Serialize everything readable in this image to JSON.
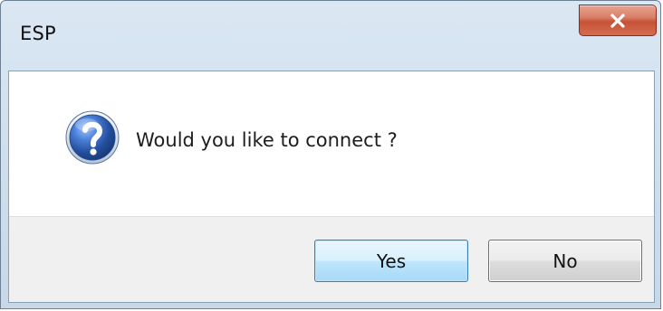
{
  "window": {
    "title": "ESP",
    "close_glyph": "x"
  },
  "dialog": {
    "icon": "question-icon",
    "message": "Would you like to connect ?"
  },
  "buttons": {
    "yes_label": "Yes",
    "no_label": "No"
  },
  "colors": {
    "close_button": "#c75236",
    "question_icon": "#2f5fae",
    "default_button_border": "#3c7fb1"
  }
}
